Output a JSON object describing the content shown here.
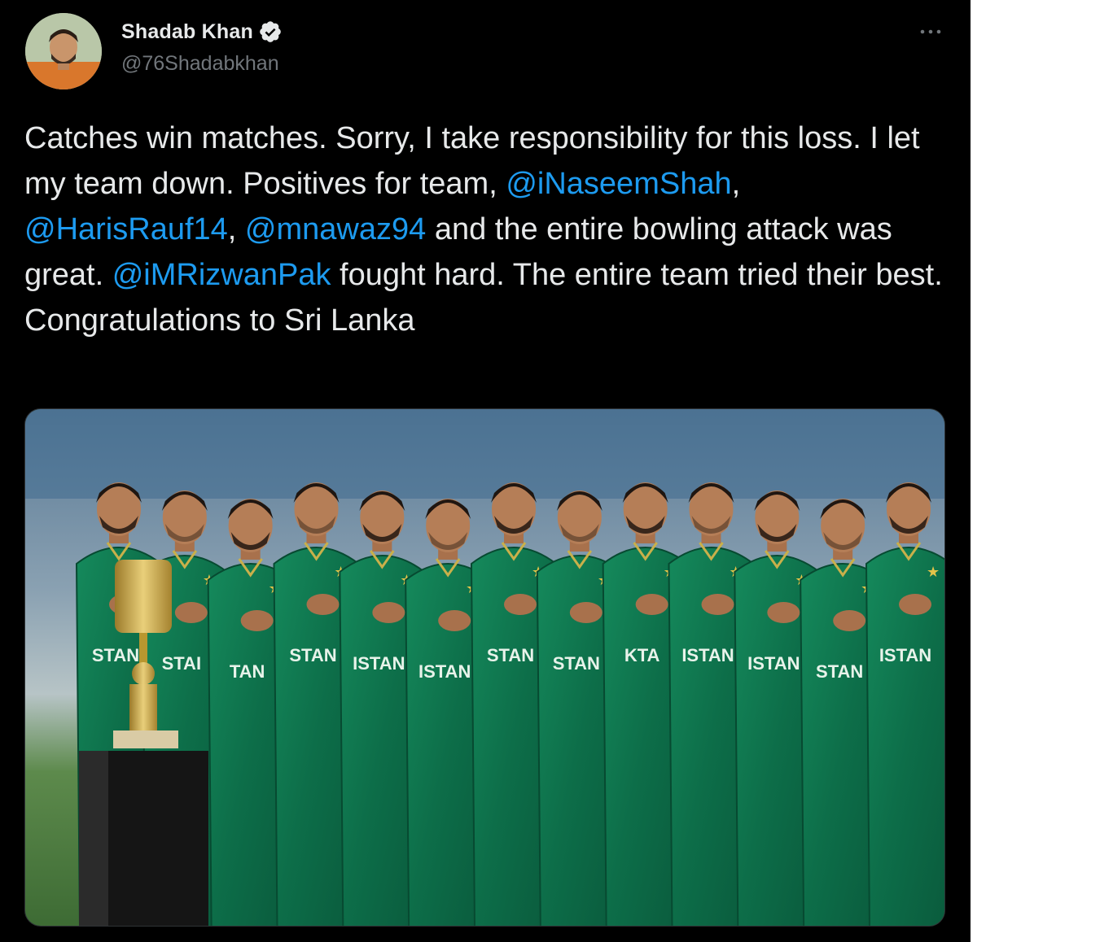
{
  "tweet": {
    "author": {
      "display_name": "Shadab Khan",
      "handle": "@76Shadabkhan",
      "verified": true
    },
    "more_label": "···",
    "text_segments": [
      {
        "type": "text",
        "value": "Catches win matches. Sorry, I take responsibility for this loss. I let my team down. Positives for team, "
      },
      {
        "type": "mention",
        "value": "@iNaseemShah"
      },
      {
        "type": "text",
        "value": ", "
      },
      {
        "type": "mention",
        "value": "@HarisRauf14"
      },
      {
        "type": "text",
        "value": ", "
      },
      {
        "type": "mention",
        "value": "@mnawaz94"
      },
      {
        "type": "text",
        "value": " and the entire bowling attack was great. "
      },
      {
        "type": "mention",
        "value": "@iMRizwanPak"
      },
      {
        "type": "text",
        "value": " fought hard. The entire team tried their best. Congratulations to Sri Lanka"
      }
    ],
    "media": {
      "description_icon": "team-photo-image",
      "jersey_text": [
        "STAN",
        "STAI",
        "TAN",
        "STAN",
        "ISTAN",
        "ISTAN",
        "STAN",
        "STAN",
        "KTA",
        "ISTAN",
        "ISTAN",
        "STAN",
        "ISTAN"
      ]
    }
  },
  "colors": {
    "background": "#000000",
    "text": "#e7e9ea",
    "secondary": "#71767b",
    "link": "#1d9bf0",
    "jersey": "#0e6b4a"
  }
}
